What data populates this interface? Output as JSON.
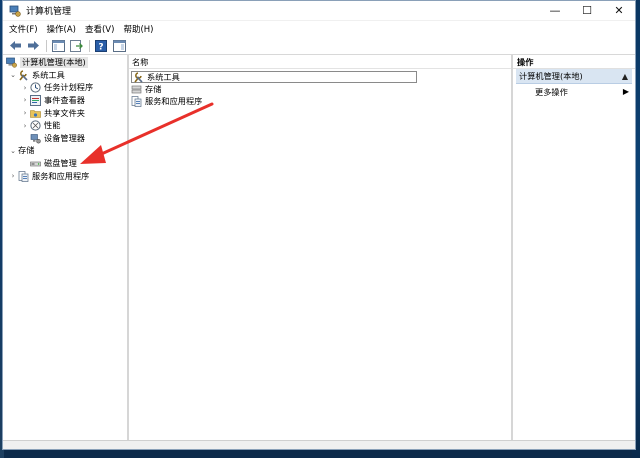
{
  "window": {
    "title": "计算机管理",
    "controls": {
      "minimize": "—",
      "maximize": "☐",
      "close": "✕"
    }
  },
  "menu": [
    "文件(F)",
    "操作(A)",
    "查看(V)",
    "帮助(H)"
  ],
  "tree": {
    "root": "计算机管理(本地)",
    "system_tools": "系统工具",
    "task_scheduler": "任务计划程序",
    "event_viewer": "事件查看器",
    "shared_folders": "共享文件夹",
    "performance": "性能",
    "device_manager": "设备管理器",
    "storage": "存储",
    "disk_management": "磁盘管理",
    "services_apps": "服务和应用程序"
  },
  "main": {
    "column_name": "名称",
    "rows": [
      "系统工具",
      "存储",
      "服务和应用程序"
    ]
  },
  "actions": {
    "header": "操作",
    "group": "计算机管理(本地)",
    "more": "更多操作"
  },
  "colors": {
    "selection_blue": "#d9e5f2",
    "annotation_arrow": "#e8302a"
  }
}
